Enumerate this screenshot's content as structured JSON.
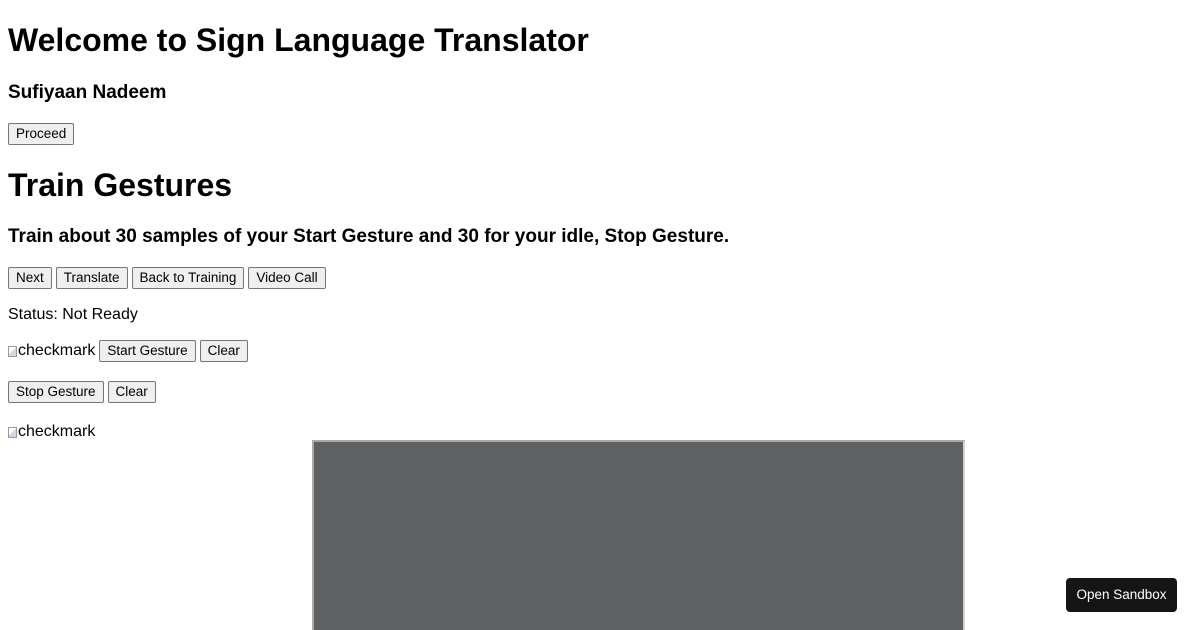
{
  "welcome": {
    "title": "Welcome to Sign Language Translator",
    "author": "Sufiyaan Nadeem",
    "proceed_label": "Proceed"
  },
  "training": {
    "title": "Train Gestures",
    "instructions": "Train about 30 samples of your Start Gesture and 30 for your idle, Stop Gesture.",
    "nav_buttons": [
      "Next",
      "Translate",
      "Back to Training",
      "Video Call"
    ],
    "status": "Status: Not Ready",
    "start_row": {
      "image_alt": "checkmark",
      "start_label": "Start Gesture",
      "clear_label": "Clear"
    },
    "stop_row": {
      "stop_label": "Stop Gesture",
      "clear_label": "Clear"
    },
    "checkmark_alt": "checkmark"
  },
  "video": {
    "background_color": "#5f6062"
  },
  "sandbox": {
    "label": "Open Sandbox"
  }
}
